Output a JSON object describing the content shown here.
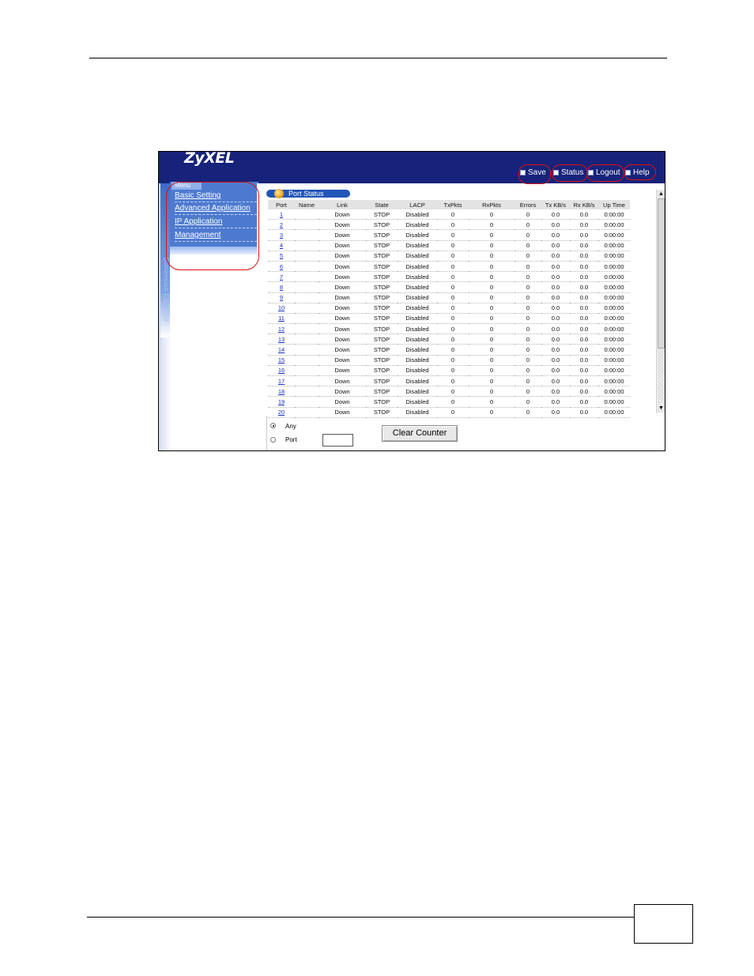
{
  "brand": {
    "logo": "ZyXEL"
  },
  "toolbar": [
    {
      "id": "save",
      "label": "Save",
      "icon": "save-icon"
    },
    {
      "id": "status",
      "label": "Status",
      "icon": "status-icon"
    },
    {
      "id": "logout",
      "label": "Logout",
      "icon": "logout-icon"
    },
    {
      "id": "help",
      "label": "Help",
      "icon": "help-icon"
    }
  ],
  "sidebar": {
    "tab": "Menu",
    "vertical_text": "Dimension ES-2708",
    "items": [
      {
        "label": "Basic Setting"
      },
      {
        "label": "Advanced Application"
      },
      {
        "label": "IP Application"
      },
      {
        "label": "Management"
      }
    ]
  },
  "port_status": {
    "title": "Port Status",
    "columns": [
      "Port",
      "Name",
      "Link",
      "State",
      "LACP",
      "TxPkts",
      "RxPkts",
      "Errors",
      "Tx KB/s",
      "Rx KB/s",
      "Up Time"
    ],
    "rows": [
      [
        "1",
        "",
        "Down",
        "STOP",
        "Disabled",
        "0",
        "0",
        "0",
        "0.0",
        "0.0",
        "0:00:00"
      ],
      [
        "2",
        "",
        "Down",
        "STOP",
        "Disabled",
        "0",
        "0",
        "0",
        "0.0",
        "0.0",
        "0:00:00"
      ],
      [
        "3",
        "",
        "Down",
        "STOP",
        "Disabled",
        "0",
        "0",
        "0",
        "0.0",
        "0.0",
        "0:00:00"
      ],
      [
        "4",
        "",
        "Down",
        "STOP",
        "Disabled",
        "0",
        "0",
        "0",
        "0.0",
        "0.0",
        "0:00:00"
      ],
      [
        "5",
        "",
        "Down",
        "STOP",
        "Disabled",
        "0",
        "0",
        "0",
        "0.0",
        "0.0",
        "0:00:00"
      ],
      [
        "6",
        "",
        "Down",
        "STOP",
        "Disabled",
        "0",
        "0",
        "0",
        "0.0",
        "0.0",
        "0:00:00"
      ],
      [
        "7",
        "",
        "Down",
        "STOP",
        "Disabled",
        "0",
        "0",
        "0",
        "0.0",
        "0.0",
        "0:00:00"
      ],
      [
        "8",
        "",
        "Down",
        "STOP",
        "Disabled",
        "0",
        "0",
        "0",
        "0.0",
        "0.0",
        "0:00:00"
      ],
      [
        "9",
        "",
        "Down",
        "STOP",
        "Disabled",
        "0",
        "0",
        "0",
        "0.0",
        "0.0",
        "0:00:00"
      ],
      [
        "10",
        "",
        "Down",
        "STOP",
        "Disabled",
        "0",
        "0",
        "0",
        "0.0",
        "0.0",
        "0:00:00"
      ],
      [
        "11",
        "",
        "Down",
        "STOP",
        "Disabled",
        "0",
        "0",
        "0",
        "0.0",
        "0.0",
        "0:00:00"
      ],
      [
        "12",
        "",
        "Down",
        "STOP",
        "Disabled",
        "0",
        "0",
        "0",
        "0.0",
        "0.0",
        "0:00:00"
      ],
      [
        "13",
        "",
        "Down",
        "STOP",
        "Disabled",
        "0",
        "0",
        "0",
        "0.0",
        "0.0",
        "0:00:00"
      ],
      [
        "14",
        "",
        "Down",
        "STOP",
        "Disabled",
        "0",
        "0",
        "0",
        "0.0",
        "0.0",
        "0:00:00"
      ],
      [
        "15",
        "",
        "Down",
        "STOP",
        "Disabled",
        "0",
        "0",
        "0",
        "0.0",
        "0.0",
        "0:00:00"
      ],
      [
        "16",
        "",
        "Down",
        "STOP",
        "Disabled",
        "0",
        "0",
        "0",
        "0.0",
        "0.0",
        "0:00:00"
      ],
      [
        "17",
        "",
        "Down",
        "STOP",
        "Disabled",
        "0",
        "0",
        "0",
        "0.0",
        "0.0",
        "0:00:00"
      ],
      [
        "18",
        "",
        "Down",
        "STOP",
        "Disabled",
        "0",
        "0",
        "0",
        "0.0",
        "0.0",
        "0:00:00"
      ],
      [
        "19",
        "",
        "Down",
        "STOP",
        "Disabled",
        "0",
        "0",
        "0",
        "0.0",
        "0.0",
        "0:00:00"
      ],
      [
        "20",
        "",
        "Down",
        "STOP",
        "Disabled",
        "0",
        "0",
        "0",
        "0.0",
        "0.0",
        "0:00:00"
      ]
    ]
  },
  "counter_controls": {
    "any_label": "Any",
    "port_label": "Port",
    "port_value": "",
    "selected": "Any",
    "clear_button": "Clear Counter"
  },
  "colors": {
    "topbar": "#17237a",
    "menu": "#4d7ad0",
    "highlight_ring": "#e01010"
  }
}
